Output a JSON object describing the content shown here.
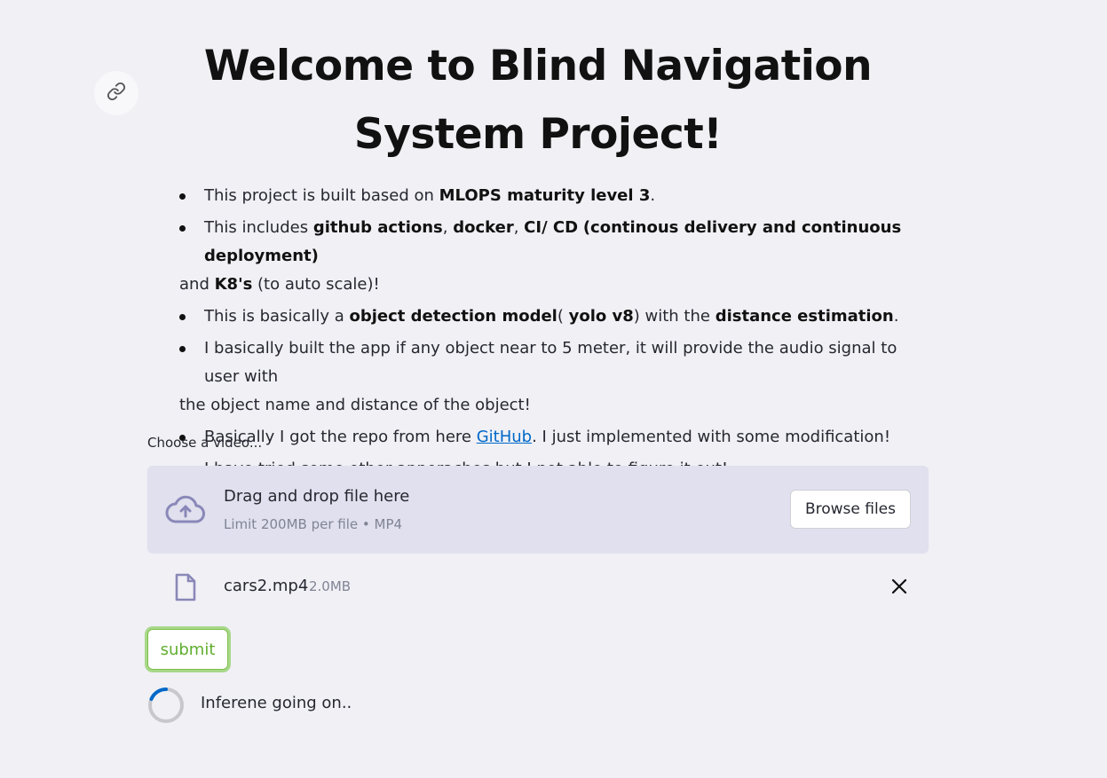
{
  "header": {
    "title_line1": "Welcome to Blind Navigation",
    "title_line2": "System Project!",
    "anchor_icon": "link-icon"
  },
  "bullets": {
    "b1": {
      "pre": "This project is built based on ",
      "bold": "MLOPS maturity level 3",
      "post": "."
    },
    "b2": {
      "pre": "This includes ",
      "bold1": "github actions",
      "sep1": ", ",
      "bold2": "docker",
      "sep2": ", ",
      "bold3": "CI/ CD",
      "sep3": " ",
      "bold4": "(continous delivery and continuous deployment)",
      "line2_pre": "and ",
      "bold5": "K8's",
      "post": " (to auto scale)!"
    },
    "b3": {
      "pre": "This is basically a ",
      "bold1": "object detection model",
      "mid1": "( ",
      "bold2": "yolo v8",
      "mid2": ") with the ",
      "bold3": "distance estimation",
      "post": "."
    },
    "b4": {
      "line1": "I basically built the app if any object near to 5 meter, it will provide the audio signal to user with",
      "line2": "the object name and distance of the object!"
    },
    "b5": {
      "pre": "Basically I got the repo from here ",
      "link": "GitHub",
      "post": ". I just implemented with some modification!"
    },
    "b6": {
      "text": "I have tried some other apporaches but I not able to figure it out!"
    }
  },
  "uploader": {
    "label": "Choose a video...",
    "drop_title": "Drag and drop file here",
    "drop_sub": "Limit 200MB per file • MP4",
    "browse_label": "Browse files",
    "upload_icon": "cloud-upload-icon"
  },
  "file": {
    "name": "cars2.mp4",
    "size": "2.0MB",
    "file_icon": "file-icon",
    "remove_icon": "close-icon"
  },
  "submit": {
    "label": "submit"
  },
  "status": {
    "text": "Inferene going on..",
    "spinner_icon": "spinner-icon"
  },
  "colors": {
    "background": "#f0f0f5",
    "dropzone": "#e0e0ee",
    "link": "#0068c9",
    "submit_border": "#7fbf4a",
    "spinner": "#0068c9"
  }
}
